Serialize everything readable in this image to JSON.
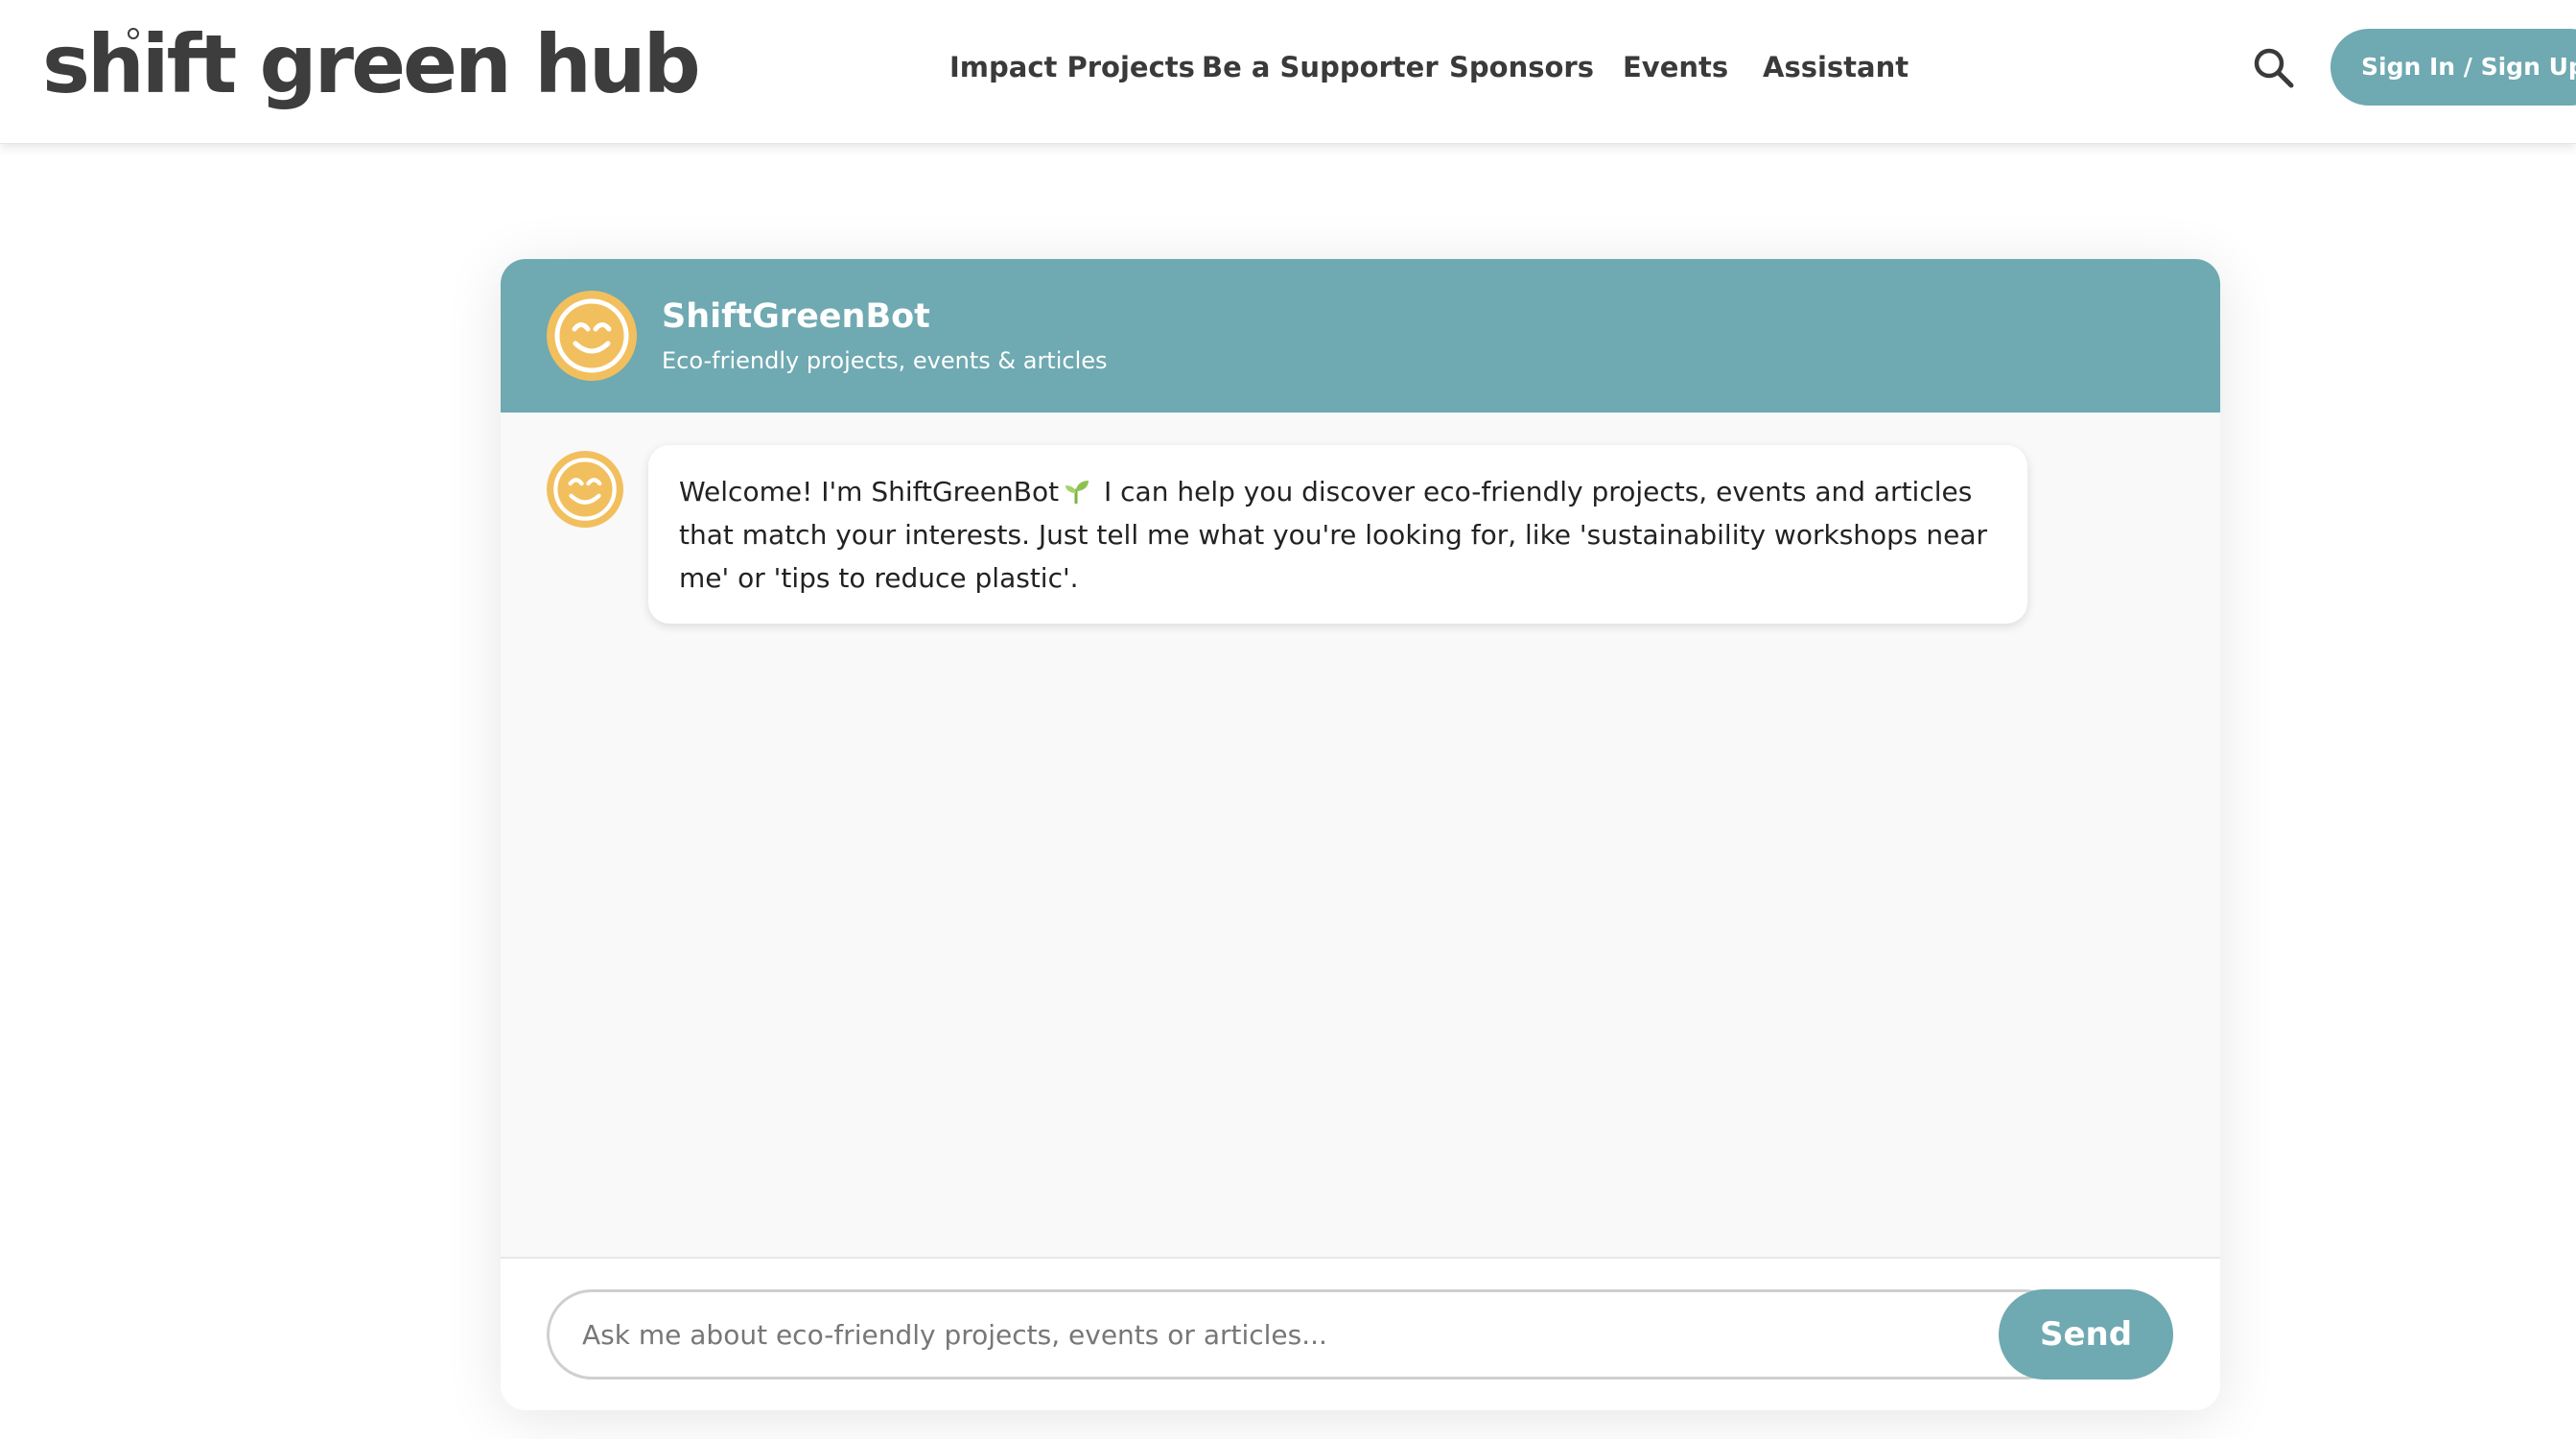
{
  "site": {
    "logo_text": "shift green hub"
  },
  "nav": {
    "items": [
      {
        "label": "Impact Projects"
      },
      {
        "label": "Be a Supporter"
      },
      {
        "label": "Sponsors"
      },
      {
        "label": "Events"
      },
      {
        "label": "Assistant"
      }
    ],
    "search_icon": "search-icon",
    "signin_label": "Sign In / Sign Up"
  },
  "chat": {
    "bot_name": "ShiftGreenBot",
    "bot_subtitle": "Eco-friendly projects, events & articles",
    "avatar_icon": "smiley-face-icon",
    "messages": [
      {
        "sender": "bot",
        "text_before": "Welcome! I'm ShiftGreenBot",
        "icon": "sprout-icon",
        "text_after": "I can help you discover eco-friendly projects, events and articles that match your interests. Just tell me what you're looking for, like 'sustainability workshops near me' or 'tips to reduce plastic'."
      }
    ],
    "input_placeholder": "Ask me about eco-friendly projects, events or articles...",
    "input_value": "",
    "send_label": "Send"
  },
  "colors": {
    "accent": "#6fa9b1",
    "avatar": "#f2bf5e",
    "sprout": "#7bb341",
    "text_dark": "#3a3a3a"
  }
}
